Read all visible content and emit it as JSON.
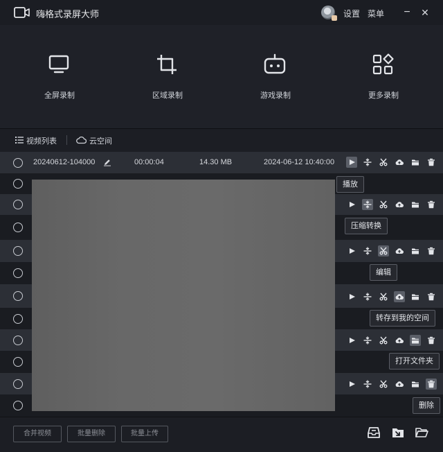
{
  "app": {
    "title": "嗨格式录屏大师"
  },
  "titlebar": {
    "settings_label": "设置",
    "menu_label": "菜单",
    "minimize_symbol": "−",
    "close_symbol": "✕"
  },
  "modes": [
    {
      "label": "全屏录制",
      "icon": "monitor-icon"
    },
    {
      "label": "区域录制",
      "icon": "crop-icon"
    },
    {
      "label": "游戏录制",
      "icon": "gamepad-icon"
    },
    {
      "label": "更多录制",
      "icon": "apps-icon"
    }
  ],
  "tabs": {
    "video_list": "视频列表",
    "cloud_space": "云空间"
  },
  "recording": {
    "name": "20240612-104000",
    "duration": "00:00:04",
    "size": "14.30 MB",
    "date": "2024-06-12 10:40:00"
  },
  "row_actions": [
    "play-icon",
    "compress-icon",
    "edit-icon",
    "upload-icon",
    "folder-icon",
    "delete-icon"
  ],
  "tooltips": {
    "play": "播放",
    "compress": "压缩转换",
    "edit": "编辑",
    "save_to_space": "转存到我的空间",
    "open_folder": "打开文件夹",
    "delete": "删除"
  },
  "bottom": {
    "merge": "合并视频",
    "batch_delete": "批量删除",
    "batch_upload": "批量上传"
  },
  "colors": {
    "background": "#1c1e24",
    "row_light": "#2c2f36",
    "row_dark": "#1a1c21",
    "text": "#d5d7dc"
  }
}
